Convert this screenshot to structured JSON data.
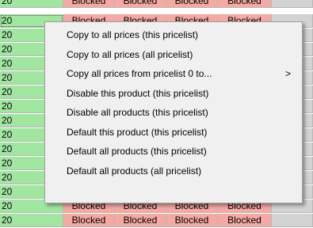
{
  "colors": {
    "qty_cell_bg": "#a0e6a0",
    "blocked_cell_bg": "#f4a9a2",
    "empty_cell_bg": "#d3d3d3",
    "menu_bg": "#f0f0f0"
  },
  "grid": {
    "rows": [
      {
        "qty": "20",
        "prices": [
          "Blocked",
          "Blocked",
          "Blocked",
          "Blocked"
        ]
      },
      {
        "qty": "20",
        "prices": [
          "Blocked",
          "Blocked",
          "Blocked",
          "Blocked"
        ]
      },
      {
        "qty": "20",
        "prices": [
          "",
          "",
          "",
          ""
        ]
      },
      {
        "qty": "20",
        "prices": [
          "",
          "",
          "",
          ""
        ]
      },
      {
        "qty": "20",
        "prices": [
          "",
          "",
          "",
          ""
        ]
      },
      {
        "qty": "20",
        "prices": [
          "",
          "",
          "",
          ""
        ]
      },
      {
        "qty": "20",
        "prices": [
          "",
          "",
          "",
          ""
        ]
      },
      {
        "qty": "20",
        "prices": [
          "",
          "",
          "",
          ""
        ]
      },
      {
        "qty": "20",
        "prices": [
          "",
          "",
          "",
          ""
        ]
      },
      {
        "qty": "20",
        "prices": [
          "",
          "",
          "",
          ""
        ]
      },
      {
        "qty": "20",
        "prices": [
          "",
          "",
          "",
          ""
        ]
      },
      {
        "qty": "20",
        "prices": [
          "",
          "",
          "",
          ""
        ]
      },
      {
        "qty": "20",
        "prices": [
          "",
          "",
          "",
          ""
        ]
      },
      {
        "qty": "20",
        "prices": [
          "",
          "",
          "",
          ""
        ]
      },
      {
        "qty": "20",
        "prices": [
          "Blocked",
          "Blocked",
          "Blocked",
          "Blocked"
        ]
      },
      {
        "qty": "20",
        "prices": [
          "Blocked",
          "Blocked",
          "Blocked",
          "Blocked"
        ]
      }
    ]
  },
  "context_menu": {
    "items": [
      {
        "label": "Copy to all prices (this pricelist)",
        "has_submenu": false
      },
      {
        "label": "Copy to all prices (all pricelist)",
        "has_submenu": false
      },
      {
        "label": "Copy all prices from pricelist 0 to...",
        "has_submenu": true,
        "submenu_arrow": ">"
      },
      {
        "label": "Disable this product (this pricelist)",
        "has_submenu": false
      },
      {
        "label": "Disable all products (this pricelist)",
        "has_submenu": false
      },
      {
        "label": "Default this product (this pricelist)",
        "has_submenu": false
      },
      {
        "label": "Default all products (this pricelist)",
        "has_submenu": false
      },
      {
        "label": "Default all products (all pricelist)",
        "has_submenu": false
      }
    ]
  }
}
